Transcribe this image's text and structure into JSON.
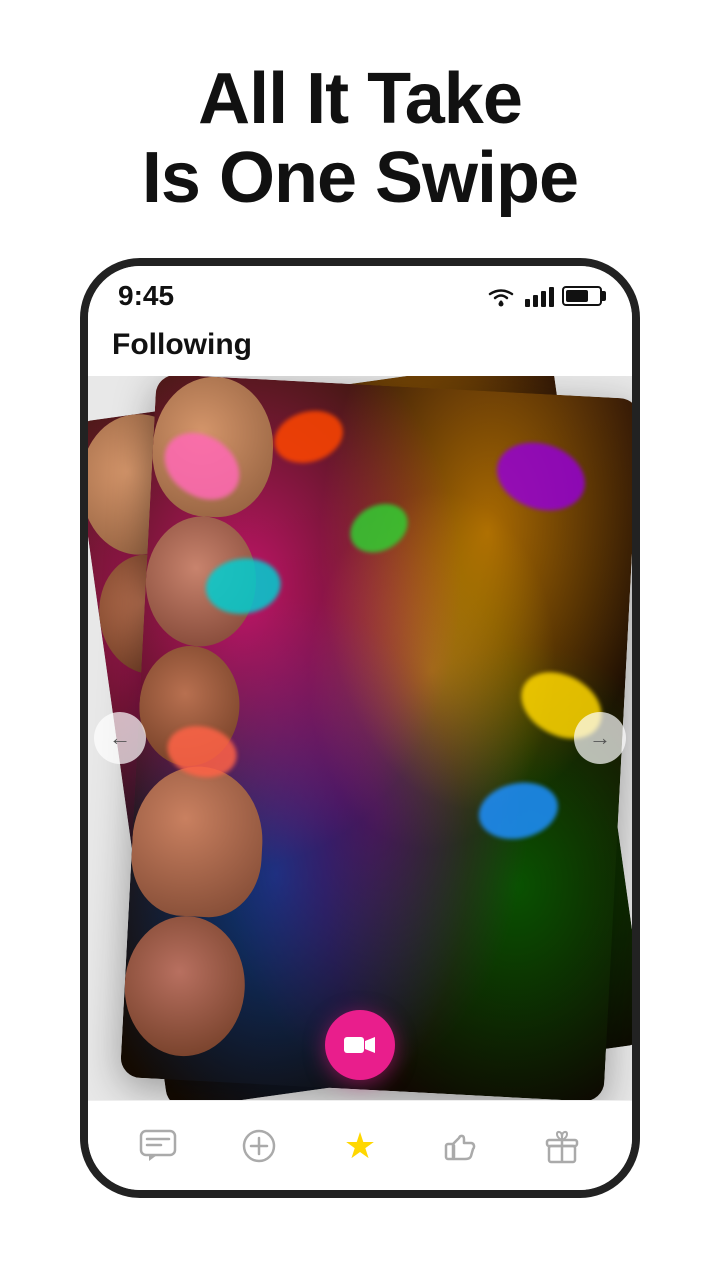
{
  "headline": {
    "line1": "All It Take",
    "line2": "Is One Swipe"
  },
  "status_bar": {
    "time": "9:45",
    "wifi": "wifi",
    "signal": "signal",
    "battery": "battery"
  },
  "app_header": {
    "title": "Following"
  },
  "arrows": {
    "left": "←",
    "right": "→"
  },
  "bottom_nav": {
    "items": [
      {
        "id": "chat",
        "label": "Chat",
        "active": false
      },
      {
        "id": "add",
        "label": "Add",
        "active": false
      },
      {
        "id": "star",
        "label": "Star",
        "active": true
      },
      {
        "id": "like",
        "label": "Like",
        "active": false
      },
      {
        "id": "gift",
        "label": "Gift",
        "active": false
      }
    ]
  }
}
